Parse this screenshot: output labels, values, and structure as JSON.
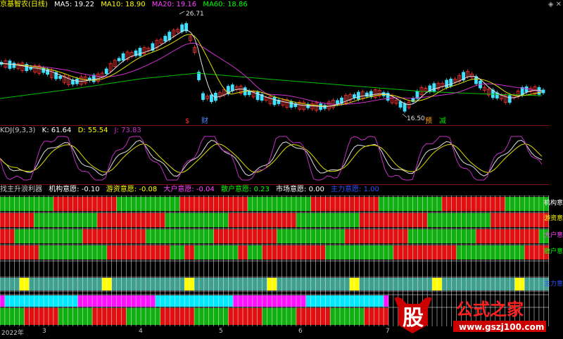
{
  "main": {
    "title": "京基智农(日线)",
    "ma": [
      {
        "label": "MA5: 19.22",
        "color": "#ffffff"
      },
      {
        "label": "MA10: 18.90",
        "color": "#ffff00"
      },
      {
        "label": "MA20: 19.16",
        "color": "#ff40ff"
      },
      {
        "label": "MA60: 18.86",
        "color": "#00ff00"
      }
    ],
    "high_label": "26.71",
    "low_label": "16.50",
    "tags": [
      {
        "text": "$",
        "color": "#ff3030"
      },
      {
        "text": "财",
        "color": "#4a8cff"
      },
      {
        "text": "预",
        "color": "#ffa500"
      },
      {
        "text": "减",
        "color": "#00e000"
      }
    ]
  },
  "kdj": {
    "title": "KDJ(9,3,3)",
    "k": "K: 61.64",
    "d": "D: 55.54",
    "j": "J: 73.83"
  },
  "indicator": {
    "title": "找主升浪利器",
    "items": [
      {
        "label": "机构意愿: -0.10",
        "color": "#ffffff"
      },
      {
        "label": "游资意愿: -0.08",
        "color": "#ffff00"
      },
      {
        "label": "大户意愿: -0.04",
        "color": "#ff40ff"
      },
      {
        "label": "散户意愿: 0.23",
        "color": "#00ff00"
      },
      {
        "label": "市场意愿: 0.00",
        "color": "#ffffff"
      },
      {
        "label": "主力意愿: 1.00",
        "color": "#3050ff"
      }
    ],
    "row_labels": [
      {
        "text": "机构意",
        "color": "#ffffff"
      },
      {
        "text": "游资意",
        "color": "#ffff00"
      },
      {
        "text": "大户意",
        "color": "#ff40ff"
      },
      {
        "text": "散户意",
        "color": "#00ff00"
      },
      {
        "text": "主力意",
        "color": "#3050ff"
      }
    ]
  },
  "axis": {
    "labels": [
      "2022年",
      "3",
      "4",
      "5",
      "6",
      "7"
    ]
  },
  "watermark": {
    "text": "公式之家",
    "url": "www.gszj100.com",
    "badge": "股"
  },
  "colors": {
    "red": "#e01010",
    "green": "#10b010",
    "cyan": "#00e8ff",
    "magenta": "#ff10ff",
    "yellow": "#ffff00",
    "teal": "#40a090"
  }
}
